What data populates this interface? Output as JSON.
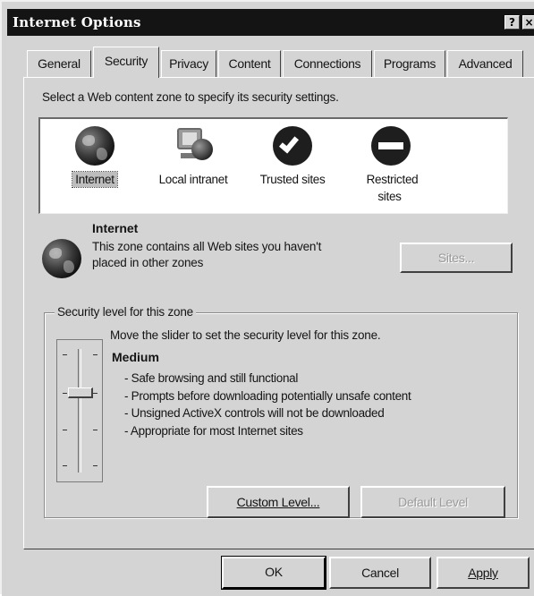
{
  "window": {
    "title": "Internet Options",
    "help_button": "?",
    "close_button": "×"
  },
  "tabs": [
    {
      "label": "General",
      "active": false
    },
    {
      "label": "Security",
      "active": true
    },
    {
      "label": "Privacy",
      "active": false
    },
    {
      "label": "Content",
      "active": false
    },
    {
      "label": "Connections",
      "active": false
    },
    {
      "label": "Programs",
      "active": false
    },
    {
      "label": "Advanced",
      "active": false
    }
  ],
  "security": {
    "prompt": "Select a Web content zone to specify its security settings.",
    "zones": [
      {
        "label": "Internet",
        "icon": "globe-icon",
        "selected": true
      },
      {
        "label": "Local intranet",
        "icon": "intranet-icon",
        "selected": false
      },
      {
        "label": "Trusted sites",
        "icon": "checkmark-icon",
        "selected": false
      },
      {
        "label": "Restricted sites",
        "icon": "no-entry-icon",
        "selected": false
      }
    ],
    "selected_zone": {
      "title": "Internet",
      "description": "This zone contains all Web sites you haven't placed in other zones"
    },
    "sites_button": "Sites...",
    "security_level": {
      "legend": "Security level for this zone",
      "hint": "Move the slider to set the security level for this zone.",
      "level": "Medium",
      "details": [
        "- Safe browsing and still functional",
        "- Prompts before downloading potentially unsafe content",
        "- Unsigned ActiveX controls will not be downloaded",
        "- Appropriate for most Internet sites"
      ]
    },
    "custom_level_button": "Custom Level...",
    "default_level_button": "Default Level"
  },
  "dialog_buttons": {
    "ok": "OK",
    "cancel": "Cancel",
    "apply": "Apply"
  }
}
